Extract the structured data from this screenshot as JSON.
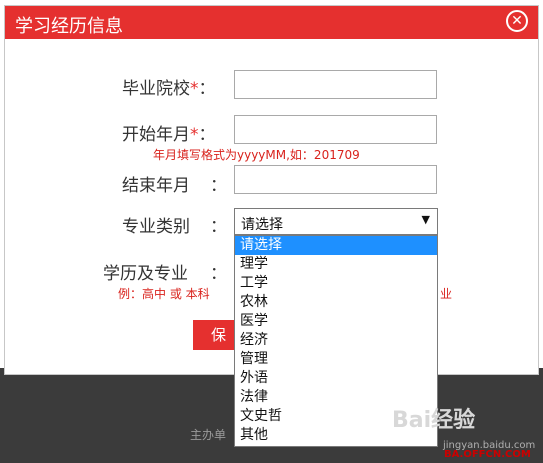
{
  "dialog": {
    "title": "学习经历信息",
    "close_icon": "close-circle-icon"
  },
  "form": {
    "school_label": "毕业院校",
    "start_label": "开始年月",
    "required_mark": "*",
    "colon": "：",
    "start_hint": "年月填写格式为yyyyMM,如：201709",
    "end_label": "结束年月",
    "category_label": "专业类别",
    "degree_label": "学历及专业",
    "degree_hint": "例：高中 或 本科",
    "degree_hint_tail": "业",
    "save_label": "保存"
  },
  "select": {
    "value": "请选择",
    "arrow_icon": "dropdown-arrow-icon",
    "options": [
      "请选择",
      "理学",
      "工学",
      "农林",
      "医学",
      "经济",
      "管理",
      "外语",
      "法律",
      "文史哲",
      "其他"
    ],
    "selected_index": 0
  },
  "footer": {
    "text": "主办单"
  },
  "watermark": {
    "baidu": "Bai经验",
    "url": "jingyan.baidu.com",
    "site": "BA.OFFCN.COM"
  },
  "colors": {
    "accent": "#e5302f",
    "selection": "#1e90ff",
    "footer_bg": "#3b3b3b"
  }
}
